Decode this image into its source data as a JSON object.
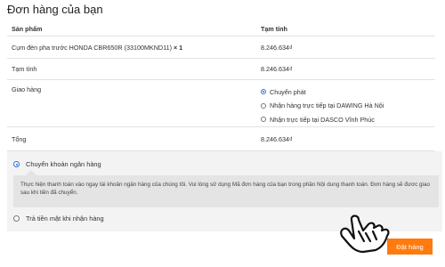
{
  "page": {
    "title": "Đơn hàng của bạn"
  },
  "table": {
    "headers": {
      "product": "Sản phẩm",
      "subtotal": "Tạm tính"
    },
    "product": {
      "name": "Cụm đèn pha trước HONDA CBR650R (33100MKND11)",
      "qty": "× 1",
      "price": "8.246.634₫"
    },
    "subtotal": {
      "label": "Tạm tính",
      "value": "8.246.634₫"
    },
    "shipping": {
      "label": "Giao hàng",
      "options": [
        {
          "label": "Chuyển phát",
          "checked": true
        },
        {
          "label": "Nhận hàng trực tiếp tại DAWING Hà Nội",
          "checked": false
        },
        {
          "label": "Nhận trực tiếp tại DASCO Vĩnh Phúc",
          "checked": false
        }
      ]
    },
    "total": {
      "label": "Tổng",
      "value": "8.246.634₫"
    }
  },
  "payment": {
    "bank": {
      "label": "Chuyển khoản ngân hàng",
      "checked": true
    },
    "bank_description": "Thực hiện thanh toán vào ngay tài khoản ngân hàng của chúng tôi. Vui lòng sử dụng Mã đơn hàng của bạn trong phần Nội dung thanh toán. Đơn hàng sẽ đươc giao sau khi tiền đã chuyển.",
    "cod": {
      "label": "Trả tiền mặt khi nhận hàng",
      "checked": false
    }
  },
  "actions": {
    "place_order": "Đặt hàng"
  },
  "colors": {
    "accent": "#ff7a0f",
    "radio": "#2b6ee0"
  },
  "icons": {
    "pointer": "hand-pointer-icon"
  }
}
